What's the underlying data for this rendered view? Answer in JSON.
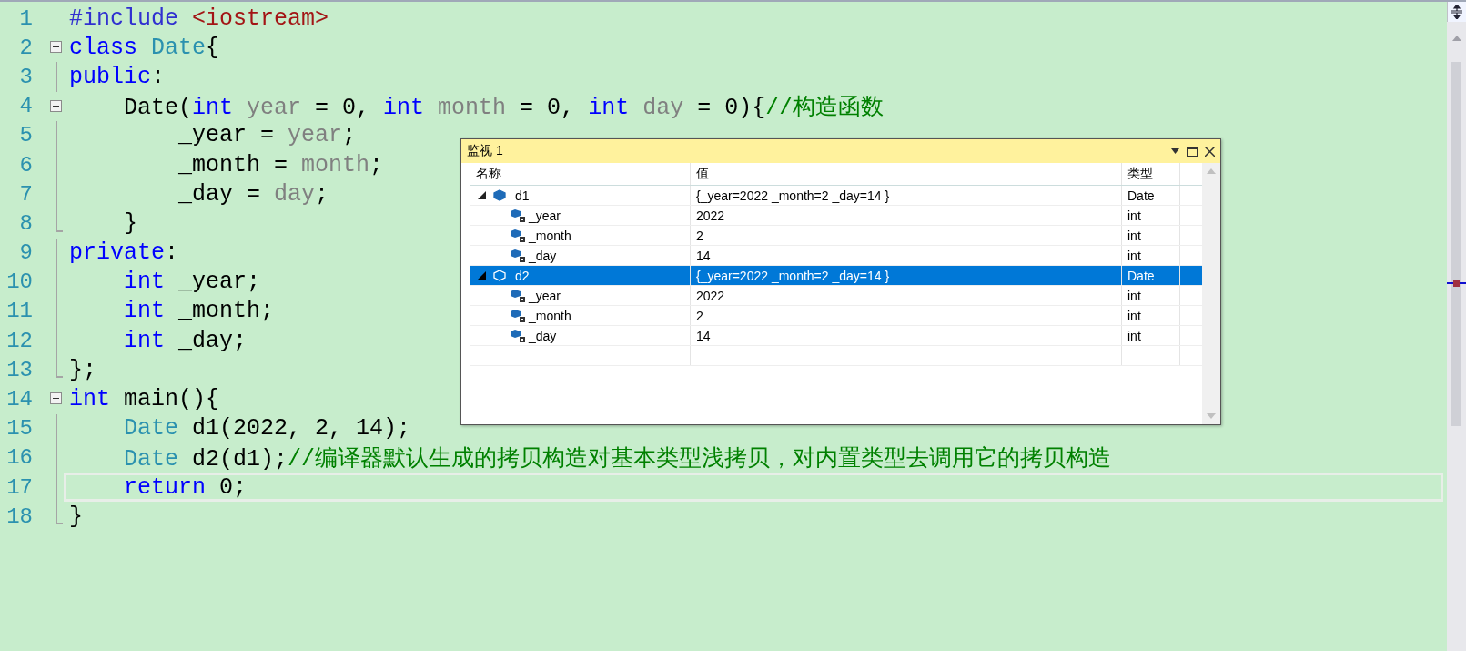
{
  "editor": {
    "lines": [
      {
        "number": "1",
        "collapsible": false,
        "in_block": false,
        "block_end": false,
        "current": false,
        "tokens": [
          {
            "kind": "preproc",
            "text": "#include "
          },
          {
            "kind": "string",
            "text": "<iostream>"
          }
        ]
      },
      {
        "number": "2",
        "collapsible": true,
        "in_block": false,
        "block_end": false,
        "current": false,
        "tokens": [
          {
            "kind": "keyword",
            "text": "class "
          },
          {
            "kind": "type",
            "text": "Date"
          },
          {
            "kind": "plain",
            "text": "{"
          }
        ]
      },
      {
        "number": "3",
        "collapsible": false,
        "in_block": true,
        "block_end": false,
        "current": false,
        "tokens": [
          {
            "kind": "keyword",
            "text": "public"
          },
          {
            "kind": "plain",
            "text": ":"
          }
        ]
      },
      {
        "number": "4",
        "collapsible": true,
        "in_block": false,
        "block_end": false,
        "current": false,
        "tokens": [
          {
            "kind": "plain",
            "text": "    Date("
          },
          {
            "kind": "keyword",
            "text": "int "
          },
          {
            "kind": "param",
            "text": "year"
          },
          {
            "kind": "plain",
            "text": " = 0, "
          },
          {
            "kind": "keyword",
            "text": "int "
          },
          {
            "kind": "param",
            "text": "month"
          },
          {
            "kind": "plain",
            "text": " = 0, "
          },
          {
            "kind": "keyword",
            "text": "int "
          },
          {
            "kind": "param",
            "text": "day"
          },
          {
            "kind": "plain",
            "text": " = 0){"
          },
          {
            "kind": "comment",
            "text": "//构造函数"
          }
        ]
      },
      {
        "number": "5",
        "collapsible": false,
        "in_block": true,
        "block_end": false,
        "current": false,
        "tokens": [
          {
            "kind": "plain",
            "text": "        _year = "
          },
          {
            "kind": "param",
            "text": "year"
          },
          {
            "kind": "plain",
            "text": ";"
          }
        ]
      },
      {
        "number": "6",
        "collapsible": false,
        "in_block": true,
        "block_end": false,
        "current": false,
        "tokens": [
          {
            "kind": "plain",
            "text": "        _month = "
          },
          {
            "kind": "param",
            "text": "month"
          },
          {
            "kind": "plain",
            "text": ";"
          }
        ]
      },
      {
        "number": "7",
        "collapsible": false,
        "in_block": true,
        "block_end": false,
        "current": false,
        "tokens": [
          {
            "kind": "plain",
            "text": "        _day = "
          },
          {
            "kind": "param",
            "text": "day"
          },
          {
            "kind": "plain",
            "text": ";"
          }
        ]
      },
      {
        "number": "8",
        "collapsible": false,
        "in_block": false,
        "block_end": true,
        "current": false,
        "tokens": [
          {
            "kind": "plain",
            "text": "    }"
          }
        ]
      },
      {
        "number": "9",
        "collapsible": false,
        "in_block": true,
        "block_end": false,
        "current": false,
        "tokens": [
          {
            "kind": "keyword",
            "text": "private"
          },
          {
            "kind": "plain",
            "text": ":"
          }
        ]
      },
      {
        "number": "10",
        "collapsible": false,
        "in_block": true,
        "block_end": false,
        "current": false,
        "tokens": [
          {
            "kind": "keyword",
            "text": "    int "
          },
          {
            "kind": "plain",
            "text": "_year;"
          }
        ]
      },
      {
        "number": "11",
        "collapsible": false,
        "in_block": true,
        "block_end": false,
        "current": false,
        "tokens": [
          {
            "kind": "keyword",
            "text": "    int "
          },
          {
            "kind": "plain",
            "text": "_month;"
          }
        ]
      },
      {
        "number": "12",
        "collapsible": false,
        "in_block": true,
        "block_end": false,
        "current": false,
        "tokens": [
          {
            "kind": "keyword",
            "text": "    int "
          },
          {
            "kind": "plain",
            "text": "_day;"
          }
        ]
      },
      {
        "number": "13",
        "collapsible": false,
        "in_block": false,
        "block_end": true,
        "current": false,
        "tokens": [
          {
            "kind": "plain",
            "text": "};"
          }
        ]
      },
      {
        "number": "14",
        "collapsible": true,
        "in_block": false,
        "block_end": false,
        "current": false,
        "tokens": [
          {
            "kind": "keyword",
            "text": "int "
          },
          {
            "kind": "plain",
            "text": "main(){"
          }
        ]
      },
      {
        "number": "15",
        "collapsible": false,
        "in_block": true,
        "block_end": false,
        "current": false,
        "tokens": [
          {
            "kind": "type",
            "text": "    Date "
          },
          {
            "kind": "plain",
            "text": "d1(2022, 2, 14);"
          }
        ]
      },
      {
        "number": "16",
        "collapsible": false,
        "in_block": true,
        "block_end": false,
        "current": false,
        "tokens": [
          {
            "kind": "type",
            "text": "    Date "
          },
          {
            "kind": "plain",
            "text": "d2(d1);"
          },
          {
            "kind": "comment",
            "text": "//编译器默认生成的拷贝构造对基本类型浅拷贝，对内置类型去调用它的拷贝构造"
          }
        ]
      },
      {
        "number": "17",
        "collapsible": false,
        "in_block": true,
        "block_end": false,
        "current": true,
        "tokens": [
          {
            "kind": "keyword",
            "text": "    return "
          },
          {
            "kind": "plain",
            "text": "0;"
          }
        ]
      },
      {
        "number": "18",
        "collapsible": false,
        "in_block": false,
        "block_end": true,
        "current": false,
        "tokens": [
          {
            "kind": "plain",
            "text": "}"
          }
        ]
      }
    ]
  },
  "watch": {
    "title": "监视 1",
    "columns": [
      "名称",
      "值",
      "类型"
    ],
    "rows": [
      {
        "name": "d1",
        "value": "{_year=2022 _month=2 _day=14 }",
        "type": "Date",
        "expanded": true,
        "selected": false,
        "children": [
          {
            "name": "_year",
            "value": "2022",
            "type": "int",
            "selected": false
          },
          {
            "name": "_month",
            "value": "2",
            "type": "int",
            "selected": false
          },
          {
            "name": "_day",
            "value": "14",
            "type": "int",
            "selected": false
          }
        ]
      },
      {
        "name": "d2",
        "value": "{_year=2022 _month=2 _day=14 }",
        "type": "Date",
        "expanded": true,
        "selected": true,
        "children": [
          {
            "name": "_year",
            "value": "2022",
            "type": "int",
            "selected": false
          },
          {
            "name": "_month",
            "value": "2",
            "type": "int",
            "selected": false
          },
          {
            "name": "_day",
            "value": "14",
            "type": "int",
            "selected": false
          }
        ]
      }
    ]
  }
}
